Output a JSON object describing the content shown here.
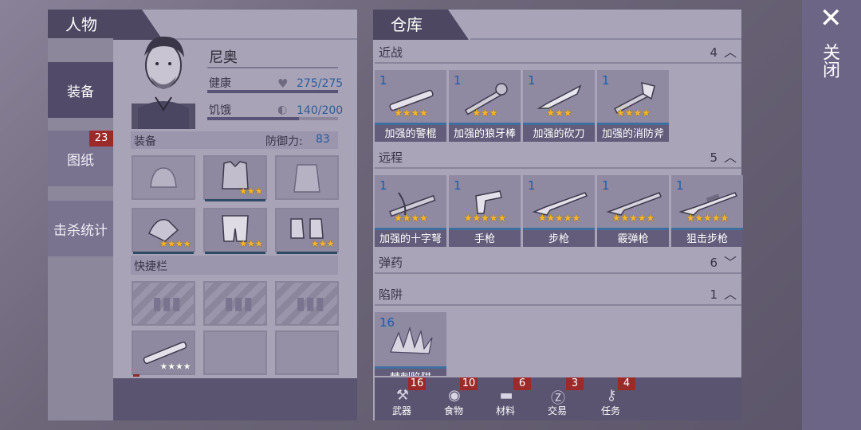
{
  "character": {
    "header": "人物",
    "name": "尼奥",
    "health_label": "健康",
    "health_value": "275/275",
    "hunger_label": "饥饿",
    "hunger_value": "140/200",
    "equipment_label": "装备",
    "defense_label": "防御力:",
    "defense_value": "83",
    "quickbar_label": "快捷栏"
  },
  "side_tabs": {
    "equip": "装备",
    "blueprint": "图纸",
    "blueprint_badge": "23",
    "kills": "击杀统计"
  },
  "warehouse": {
    "header": "仓库",
    "melee": {
      "label": "近战",
      "count": "4"
    },
    "ranged": {
      "label": "远程",
      "count": "5"
    },
    "ammo": {
      "label": "弹药",
      "count": "6"
    },
    "traps": {
      "label": "陷阱",
      "count": "1"
    },
    "melee_items": [
      {
        "count": "1",
        "name": "加强的警棍",
        "stars": "★★★★"
      },
      {
        "count": "1",
        "name": "加强的狼牙棒",
        "stars": "★★★"
      },
      {
        "count": "1",
        "name": "加强的砍刀",
        "stars": "★★★"
      },
      {
        "count": "1",
        "name": "加强的消防斧",
        "stars": "★★★★"
      }
    ],
    "ranged_items": [
      {
        "count": "1",
        "name": "加强的十字弩",
        "stars": "★★★★"
      },
      {
        "count": "1",
        "name": "手枪",
        "stars": "★★★★★"
      },
      {
        "count": "1",
        "name": "步枪",
        "stars": "★★★★★"
      },
      {
        "count": "1",
        "name": "霰弹枪",
        "stars": "★★★★★"
      },
      {
        "count": "1",
        "name": "狙击步枪",
        "stars": "★★★★★"
      }
    ],
    "trap_items": [
      {
        "count": "16",
        "name": "棘刺陷阱"
      }
    ]
  },
  "bottom_tabs": [
    {
      "label": "武器",
      "badge": "16"
    },
    {
      "label": "食物",
      "badge": "10"
    },
    {
      "label": "材料",
      "badge": "6"
    },
    {
      "label": "交易",
      "badge": "3"
    },
    {
      "label": "任务",
      "badge": "4"
    }
  ],
  "close": {
    "label": "关闭"
  },
  "equip_stars": {
    "armor": "★★★",
    "gloves": "★★★★",
    "pants": "★★★",
    "boots": "★★★",
    "quick_baton": "★★★★"
  },
  "colors": {
    "accent": "#4d4762",
    "badge": "#9c2a2a",
    "star": "#f5b52a"
  }
}
